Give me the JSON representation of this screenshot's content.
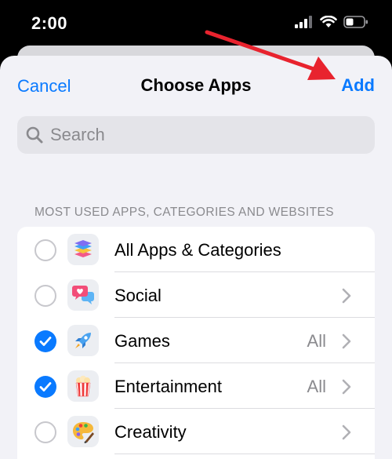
{
  "status_bar": {
    "time": "2:00"
  },
  "nav": {
    "cancel": "Cancel",
    "title": "Choose Apps",
    "add": "Add"
  },
  "search": {
    "placeholder": "Search"
  },
  "section_header": "MOST USED APPS, CATEGORIES AND WEBSITES",
  "rows": [
    {
      "label": "All Apps & Categories",
      "detail": "",
      "selected": false,
      "icon": "stack-icon",
      "chevron": false
    },
    {
      "label": "Social",
      "detail": "",
      "selected": false,
      "icon": "chat-heart-icon",
      "chevron": true
    },
    {
      "label": "Games",
      "detail": "All",
      "selected": true,
      "icon": "rocket-icon",
      "chevron": true
    },
    {
      "label": "Entertainment",
      "detail": "All",
      "selected": true,
      "icon": "popcorn-icon",
      "chevron": true
    },
    {
      "label": "Creativity",
      "detail": "",
      "selected": false,
      "icon": "palette-icon",
      "chevron": true
    }
  ],
  "colors": {
    "accent": "#0a7aff",
    "annotation_arrow": "#e8232e"
  }
}
